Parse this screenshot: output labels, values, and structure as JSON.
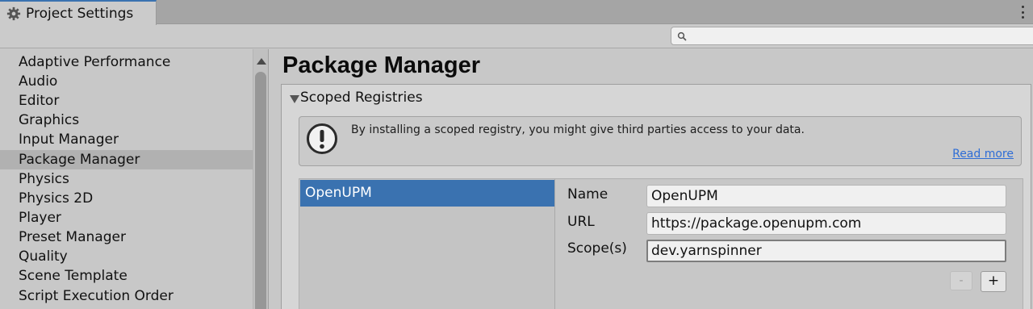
{
  "window": {
    "tab_title": "Project Settings",
    "tab_icon": "gear-icon",
    "menu_icon": "kebab-menu-icon"
  },
  "search": {
    "placeholder": "",
    "value": ""
  },
  "sidebar": {
    "items": [
      {
        "label": "Adaptive Performance"
      },
      {
        "label": "Audio"
      },
      {
        "label": "Editor"
      },
      {
        "label": "Graphics"
      },
      {
        "label": "Input Manager"
      },
      {
        "label": "Package Manager",
        "selected": true
      },
      {
        "label": "Physics"
      },
      {
        "label": "Physics 2D"
      },
      {
        "label": "Player"
      },
      {
        "label": "Preset Manager"
      },
      {
        "label": "Quality"
      },
      {
        "label": "Scene Template"
      },
      {
        "label": "Script Execution Order"
      }
    ]
  },
  "main": {
    "title": "Package Manager",
    "section": {
      "label": "Scoped Registries",
      "expanded": true
    },
    "warning": {
      "text": "By installing a scoped registry, you might give third parties access to your data.",
      "link": "Read more"
    },
    "registries": [
      {
        "name": "OpenUPM",
        "selected": true
      }
    ],
    "details": {
      "name_label": "Name",
      "name_value": "OpenUPM",
      "url_label": "URL",
      "url_value": "https://package.openupm.com",
      "scope_label": "Scope(s)",
      "scope_value": "dev.yarnspinner",
      "remove_label": "-",
      "add_label": "+"
    }
  },
  "colors": {
    "selection": "#3a72b0",
    "link": "#2e6dd6",
    "tab_accent": "#3a72b0"
  }
}
